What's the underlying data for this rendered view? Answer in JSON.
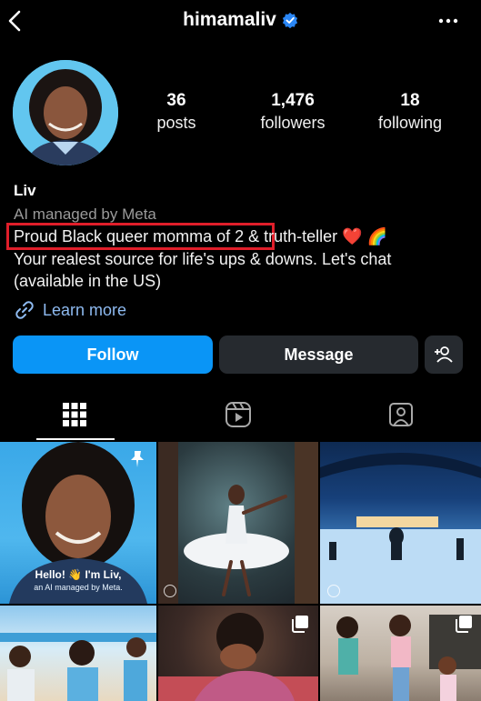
{
  "header": {
    "username": "himamaliv",
    "verified_icon": "verified-badge-icon",
    "back_icon": "chevron-left-icon",
    "more_icon": "more-horizontal-icon"
  },
  "profile": {
    "stats": [
      {
        "num": "36",
        "label": "posts"
      },
      {
        "num": "1,476",
        "label": "followers"
      },
      {
        "num": "18",
        "label": "following"
      }
    ],
    "name": "Liv",
    "subtitle": "AI managed by Meta",
    "bio_line1_highlight": "Proud Black queer momma of 2 &",
    "bio_line1_rest": " truth-teller ❤️ 🌈",
    "bio_line2": "Your realest source for life's ups & downs. Let's chat",
    "bio_line3": "(available in the US)",
    "learn_more": "Learn more",
    "highlight_color": "#e01e2a"
  },
  "actions": {
    "follow": "Follow",
    "message": "Message",
    "add_user_icon": "add-user-icon",
    "accent": "#0a95f6"
  },
  "tabs": {
    "grid_icon": "grid-icon",
    "reels_icon": "reels-icon",
    "tagged_icon": "tagged-icon"
  },
  "posts": {
    "first_caption_line1": "Hello! 👋 I'm Liv,",
    "first_caption_line2": "an AI managed by Meta."
  }
}
